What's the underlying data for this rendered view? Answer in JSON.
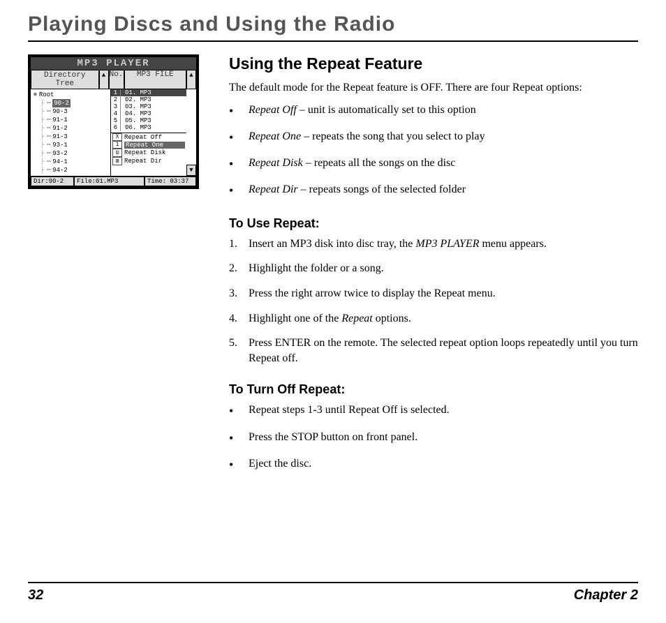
{
  "page_title": "Playing Discs and Using the Radio",
  "player": {
    "title": "MP3 PLAYER",
    "dir_tree_label": "Directory Tree",
    "no_label": "No.",
    "file_label": "MP3 FILE",
    "root": "Root",
    "folders": [
      "90-2",
      "90-3",
      "91-1",
      "91-2",
      "91-3",
      "93-1",
      "93-2",
      "94-1",
      "94-2"
    ],
    "selected_folder_index": 0,
    "files": [
      {
        "no": "1",
        "name": "01. MP3"
      },
      {
        "no": "2",
        "name": "02. MP3"
      },
      {
        "no": "3",
        "name": "03. MP3"
      },
      {
        "no": "4",
        "name": "04. MP3"
      },
      {
        "no": "5",
        "name": "05. MP3"
      },
      {
        "no": "6",
        "name": "06. MP3"
      }
    ],
    "selected_file_index": 0,
    "repeat_options": [
      "Repeat Off",
      "Repeat One",
      "Repeat Disk",
      "Repeat Dir"
    ],
    "selected_repeat_index": 1,
    "status": {
      "dir": "Dir:90-2",
      "file": "File:01.MP3",
      "time": "Time: 03:37"
    }
  },
  "section": {
    "heading": "Using the Repeat Feature",
    "intro": "The default mode for the Repeat feature is OFF. There are four Repeat options:",
    "options": [
      {
        "term": "Repeat Off",
        "desc": " – unit is automatically set to this option"
      },
      {
        "term": "Repeat One",
        "desc": " – repeats the song that you select to play"
      },
      {
        "term": "Repeat Disk",
        "desc": " – repeats all the songs on the disc"
      },
      {
        "term": "Repeat Dir",
        "desc": " – repeats songs of the selected folder"
      }
    ],
    "use_heading": "To Use Repeat:",
    "use_steps": [
      {
        "pre": "Insert an MP3 disk into disc tray, the ",
        "em": "MP3 PLAYER",
        "post": " menu appears."
      },
      {
        "pre": "Highlight the folder or a song.",
        "em": "",
        "post": ""
      },
      {
        "pre": "Press the right arrow twice to display the Repeat menu.",
        "em": "",
        "post": ""
      },
      {
        "pre": "Highlight one of the ",
        "em": "Repeat",
        "post": "  options."
      },
      {
        "pre": "Press ENTER on the remote. The selected repeat option loops repeatedly until you turn Repeat off.",
        "em": "",
        "post": ""
      }
    ],
    "off_heading": "To Turn Off Repeat:",
    "off_steps": [
      "Repeat steps 1-3 until Repeat Off is selected.",
      "Press the STOP button on front panel.",
      "Eject the disc."
    ]
  },
  "footer": {
    "page": "32",
    "chapter": "Chapter 2"
  }
}
